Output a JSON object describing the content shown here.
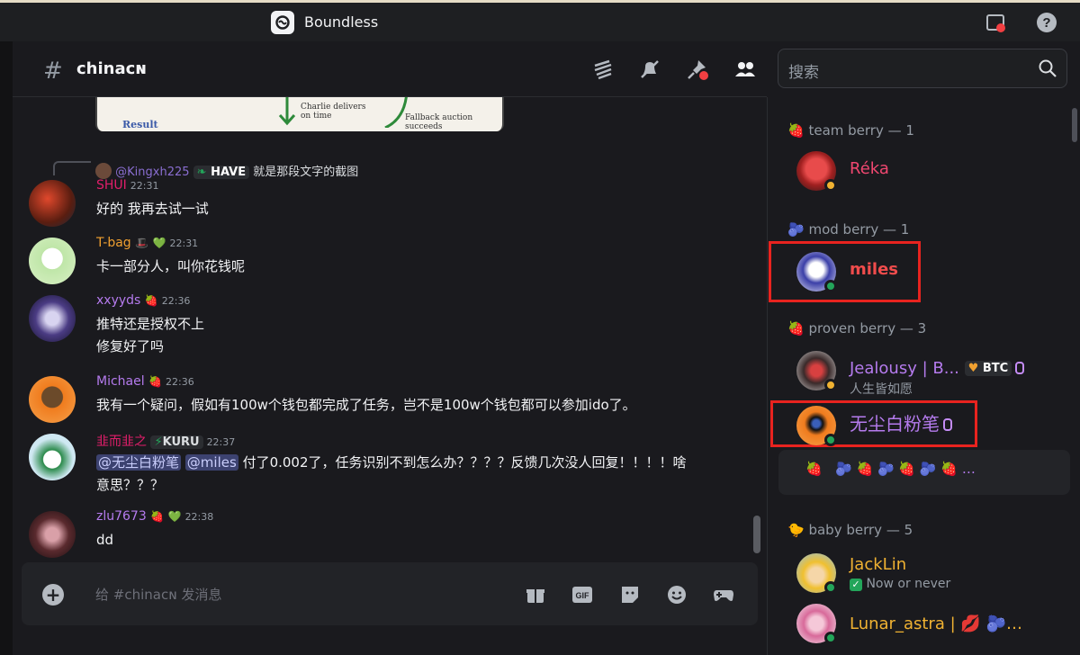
{
  "app": {
    "title": "Boundless"
  },
  "channel": {
    "name": "chinacɴ"
  },
  "search": {
    "placeholder": "搜索"
  },
  "preview": {
    "result": "Result",
    "charlie": "Charlie delivers",
    "ontime": "on time",
    "fallback": "Fallback auction",
    "succeeds": "succeeds"
  },
  "reply": {
    "author": "@Kingxh225",
    "tag": "HAVE",
    "text": "就是那段文字的截图"
  },
  "messages": [
    {
      "author": "SHUI",
      "time": "22:31",
      "lines": [
        "好的 我再去试一试"
      ]
    },
    {
      "author": "T-bag",
      "time": "22:31",
      "lines": [
        "卡一部分人，叫你花钱呢"
      ]
    },
    {
      "author": "xxyyds",
      "time": "22:36",
      "lines": [
        "推特还是授权不上",
        "修复好了吗"
      ]
    },
    {
      "author": "Michael",
      "time": "22:36",
      "lines": [
        "我有一个疑问，假如有100w个钱包都完成了任务，岂不是100w个钱包都可以参加ido了。"
      ]
    },
    {
      "author": "韭而韭之",
      "tag": "KURU",
      "time": "22:37",
      "mention1": "@无尘白粉笔",
      "mention2": "@miles",
      "line1": "付了0.002了，任务识别不到怎么办？？？？反馈几次没人回复！！！！啥",
      "line2": "意思？？？"
    },
    {
      "author": "zlu7673",
      "time": "22:38",
      "lines": [
        "dd"
      ]
    }
  ],
  "composer": {
    "placeholder": "给 #chinacɴ 发消息"
  },
  "member_groups": [
    {
      "label": "team berry — 1"
    },
    {
      "label": "mod berry — 1"
    },
    {
      "label": "proven berry — 3"
    },
    {
      "label": "baby berry — 5"
    }
  ],
  "members": [
    {
      "name": "Réka",
      "color": "#f04770"
    },
    {
      "name": "miles",
      "color": "#f04c4c"
    },
    {
      "name": "Jealousy | B...",
      "badge": "BTC",
      "sub": "人生皆如愿",
      "color": "#b57bee"
    },
    {
      "name": "无尘白粉笔",
      "color": "#b57bee"
    },
    {
      "name": "JackLin",
      "sub": "Now or never",
      "color": "#f0b232"
    },
    {
      "name": "Lunar_astra |",
      "color": "#f0b232"
    }
  ],
  "colors": {
    "bg": "#1a1a1e",
    "accent": "#5865f2",
    "online": "#23a55a",
    "highlight": "#e8231f"
  }
}
